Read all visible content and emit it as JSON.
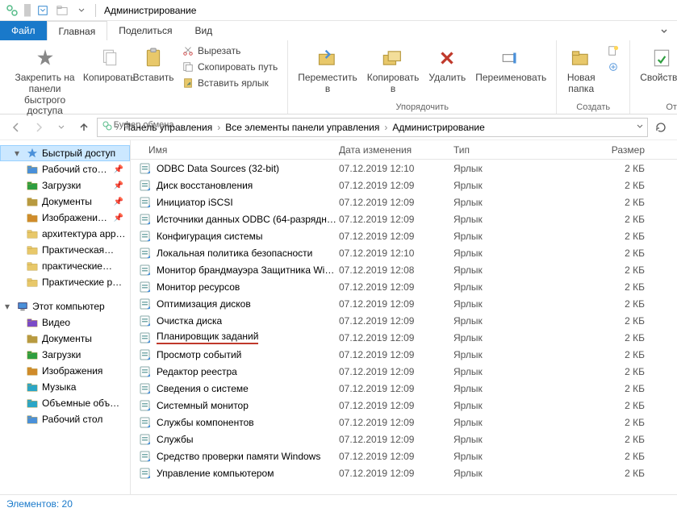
{
  "window_title": "Администрирование",
  "tabs": {
    "file": "Файл",
    "home": "Главная",
    "share": "Поделиться",
    "view": "Вид"
  },
  "ribbon": {
    "pin": "Закрепить на панели\nбыстрого доступа",
    "copy": "Копировать",
    "paste": "Вставить",
    "cut": "Вырезать",
    "copy_path": "Скопировать путь",
    "paste_shortcut": "Вставить ярлык",
    "clipboard_group": "Буфер обмена",
    "move_to": "Переместить\nв",
    "copy_to": "Копировать\nв",
    "delete": "Удалить",
    "rename": "Переименовать",
    "organize_group": "Упорядочить",
    "new_folder": "Новая\nпапка",
    "create_group": "Создать",
    "properties": "Свойства",
    "open": "Откр"
  },
  "breadcrumbs": [
    "Панель управления",
    "Все элементы панели управления",
    "Администрирование"
  ],
  "sidebar": {
    "quick_access": "Быстрый доступ",
    "items1": [
      {
        "label": "Рабочий сто…",
        "icon": "desktop",
        "pinned": true
      },
      {
        "label": "Загрузки",
        "icon": "downloads",
        "pinned": true
      },
      {
        "label": "Документы",
        "icon": "documents",
        "pinned": true
      },
      {
        "label": "Изображени…",
        "icon": "pictures",
        "pinned": true
      },
      {
        "label": "архитектура app…",
        "icon": "folder",
        "pinned": false
      },
      {
        "label": "Практическая…",
        "icon": "folder",
        "pinned": false
      },
      {
        "label": "практические…",
        "icon": "folder",
        "pinned": false
      },
      {
        "label": "Практические р…",
        "icon": "folder",
        "pinned": false
      }
    ],
    "this_pc": "Этот компьютер",
    "items2": [
      {
        "label": "Видео",
        "icon": "videos"
      },
      {
        "label": "Документы",
        "icon": "documents"
      },
      {
        "label": "Загрузки",
        "icon": "downloads"
      },
      {
        "label": "Изображения",
        "icon": "pictures"
      },
      {
        "label": "Музыка",
        "icon": "music"
      },
      {
        "label": "Объемные объ…",
        "icon": "objects3d"
      },
      {
        "label": "Рабочий стол",
        "icon": "desktop"
      }
    ]
  },
  "columns": {
    "name": "Имя",
    "date": "Дата изменения",
    "type": "Тип",
    "size": "Размер"
  },
  "files": [
    {
      "name": "ODBC Data Sources (32-bit)",
      "date": "07.12.2019 12:10",
      "type": "Ярлык",
      "size": "2 КБ",
      "hl": false
    },
    {
      "name": "Диск восстановления",
      "date": "07.12.2019 12:09",
      "type": "Ярлык",
      "size": "2 КБ",
      "hl": false
    },
    {
      "name": "Инициатор iSCSI",
      "date": "07.12.2019 12:09",
      "type": "Ярлык",
      "size": "2 КБ",
      "hl": false
    },
    {
      "name": "Источники данных ODBC (64-разрядна…",
      "date": "07.12.2019 12:09",
      "type": "Ярлык",
      "size": "2 КБ",
      "hl": false
    },
    {
      "name": "Конфигурация системы",
      "date": "07.12.2019 12:09",
      "type": "Ярлык",
      "size": "2 КБ",
      "hl": false
    },
    {
      "name": "Локальная политика безопасности",
      "date": "07.12.2019 12:10",
      "type": "Ярлык",
      "size": "2 КБ",
      "hl": false
    },
    {
      "name": "Монитор брандмауэра Защитника Win…",
      "date": "07.12.2019 12:08",
      "type": "Ярлык",
      "size": "2 КБ",
      "hl": false
    },
    {
      "name": "Монитор ресурсов",
      "date": "07.12.2019 12:09",
      "type": "Ярлык",
      "size": "2 КБ",
      "hl": false
    },
    {
      "name": "Оптимизация дисков",
      "date": "07.12.2019 12:09",
      "type": "Ярлык",
      "size": "2 КБ",
      "hl": false
    },
    {
      "name": "Очистка диска",
      "date": "07.12.2019 12:09",
      "type": "Ярлык",
      "size": "2 КБ",
      "hl": false
    },
    {
      "name": "Планировщик заданий",
      "date": "07.12.2019 12:09",
      "type": "Ярлык",
      "size": "2 КБ",
      "hl": true
    },
    {
      "name": "Просмотр событий",
      "date": "07.12.2019 12:09",
      "type": "Ярлык",
      "size": "2 КБ",
      "hl": false
    },
    {
      "name": "Редактор реестра",
      "date": "07.12.2019 12:09",
      "type": "Ярлык",
      "size": "2 КБ",
      "hl": false
    },
    {
      "name": "Сведения о системе",
      "date": "07.12.2019 12:09",
      "type": "Ярлык",
      "size": "2 КБ",
      "hl": false
    },
    {
      "name": "Системный монитор",
      "date": "07.12.2019 12:09",
      "type": "Ярлык",
      "size": "2 КБ",
      "hl": false
    },
    {
      "name": "Службы компонентов",
      "date": "07.12.2019 12:09",
      "type": "Ярлык",
      "size": "2 КБ",
      "hl": false
    },
    {
      "name": "Службы",
      "date": "07.12.2019 12:09",
      "type": "Ярлык",
      "size": "2 КБ",
      "hl": false
    },
    {
      "name": "Средство проверки памяти Windows",
      "date": "07.12.2019 12:09",
      "type": "Ярлык",
      "size": "2 КБ",
      "hl": false
    },
    {
      "name": "Управление компьютером",
      "date": "07.12.2019 12:09",
      "type": "Ярлык",
      "size": "2 КБ",
      "hl": false
    }
  ],
  "status": "Элементов: 20"
}
